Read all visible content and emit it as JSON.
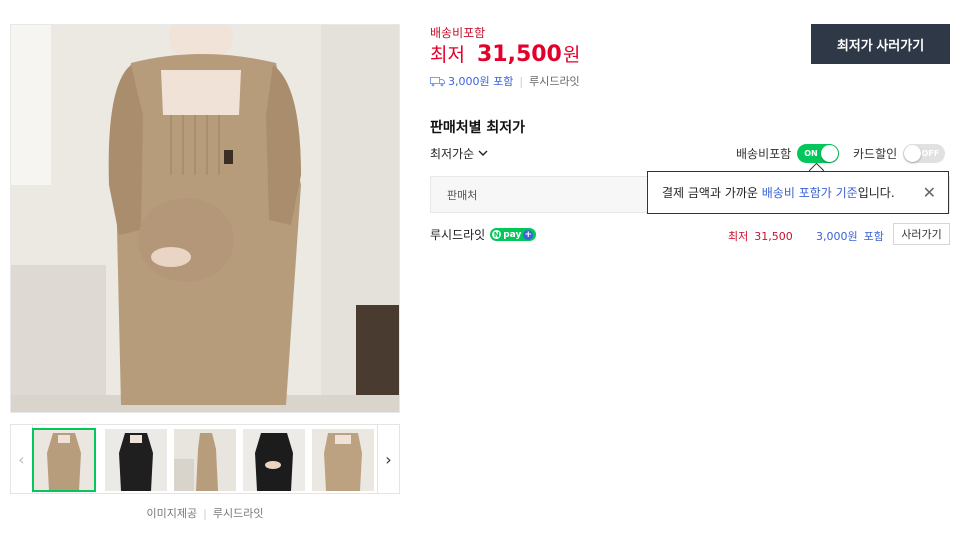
{
  "gallery": {
    "main_image_icon": "maternity-dress-photo",
    "thumbnails": [
      {
        "icon": "beige-dress-thumb",
        "selected": true
      },
      {
        "icon": "black-dress-thumb",
        "selected": false
      },
      {
        "icon": "beige-dress-full-thumb",
        "selected": false
      },
      {
        "icon": "black-dress-pregnant-thumb",
        "selected": false
      },
      {
        "icon": "beige-dress-front-thumb",
        "selected": false
      }
    ],
    "prev_arrow": "‹",
    "next_arrow": "›",
    "image_provider_label": "이미지제공",
    "image_provider_name": "루시드라잇"
  },
  "price": {
    "shipping_included_label": "배송비포함",
    "lowest_prefix": "최저",
    "lowest_value": "31,500",
    "lowest_unit": "원",
    "shipping_fee": "3,000원 포함",
    "mall_name": "루시드라잇",
    "buy_lowest_button": "최저가 사러가기"
  },
  "sellers": {
    "section_title": "판매처별 최저가",
    "sort_label": "최저가순",
    "toggle_shipping_label": "배송비포함",
    "toggle_shipping_state": "ON",
    "toggle_card_label": "카드할인",
    "toggle_card_state": "OFF",
    "header_seller": "판매처",
    "tooltip_prefix": "결제 금액과 가까운 ",
    "tooltip_highlight": "배송비 포함가 기준",
    "tooltip_suffix": "입니다.",
    "tooltip_close": "✕",
    "rows": [
      {
        "seller_name": "루시드라잇",
        "npay": "pay",
        "price_label": "최저",
        "price_value": "31,500",
        "shipping_value": "3,000원",
        "shipping_included": "포함",
        "buy_button": "사러가기"
      }
    ]
  },
  "colors": {
    "price_red": "#e4002b",
    "toggle_green": "#03c75a",
    "link_blue": "#3b63d8",
    "button_dark": "#2f3847"
  }
}
